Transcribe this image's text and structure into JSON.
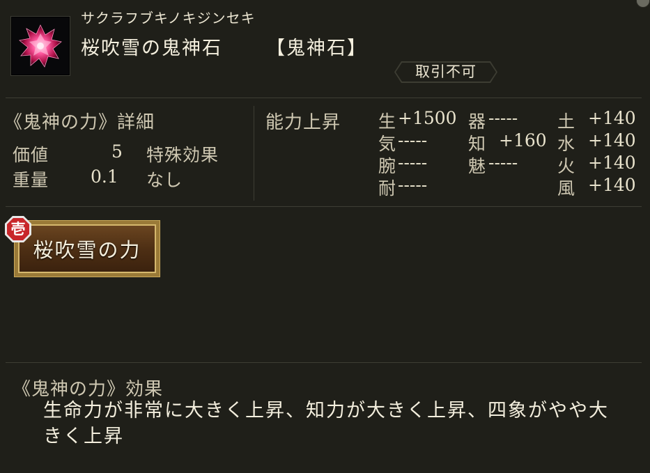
{
  "item": {
    "reading": "サクラフブキノキジンセキ",
    "name": "桜吹雪の鬼神石",
    "type": "【鬼神石】",
    "trade_status": "取引不可",
    "icon": "pink-crystal-icon"
  },
  "details": {
    "heading": "《鬼神の力》詳細",
    "value_label": "価値",
    "value": "5",
    "weight_label": "重量",
    "weight": "0.1",
    "special_label": "特殊効果",
    "special_value": "なし"
  },
  "stats": {
    "heading": "能力上昇",
    "columns": [
      [
        {
          "label": "生",
          "value": "+1500"
        },
        {
          "label": "気",
          "value": "-----"
        },
        {
          "label": "腕",
          "value": "-----"
        },
        {
          "label": "耐",
          "value": "-----"
        }
      ],
      [
        {
          "label": "器",
          "value": "-----"
        },
        {
          "label": "知",
          "value": "+160"
        },
        {
          "label": "魅",
          "value": "-----"
        }
      ],
      [
        {
          "label": "土",
          "value": "+140"
        },
        {
          "label": "水",
          "value": "+140"
        },
        {
          "label": "火",
          "value": "+140"
        },
        {
          "label": "風",
          "value": "+140"
        }
      ]
    ]
  },
  "skill": {
    "tier": "壱",
    "label": "桜吹雪の力"
  },
  "effect": {
    "heading": "《鬼神の力》効果",
    "text": "生命力が非常に大きく上昇、知力が大きく上昇、四象がやや大きく上昇"
  },
  "colors": {
    "background": "#1f1f19",
    "text": "#d4cdb8",
    "button_gold": "#d6b86e",
    "tier_red": "#c8262a"
  }
}
